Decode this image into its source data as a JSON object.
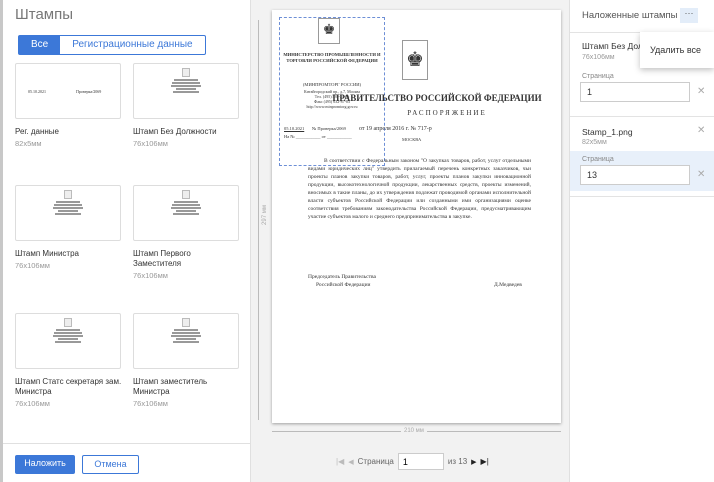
{
  "left": {
    "title": "Штампы",
    "filters": [
      "Все",
      "Регистрационные данные"
    ],
    "stamps": [
      {
        "name": "Рег. данные",
        "size": "82x5мм",
        "preview": [
          "05.10.2021",
          "Проверка/2069"
        ]
      },
      {
        "name": "Штамп Без Должности",
        "size": "76x106мм"
      },
      {
        "name": "Штамп Министра",
        "size": "76x106мм"
      },
      {
        "name": "Штамп Первого Заместителя",
        "size": "76x106мм"
      },
      {
        "name": "Штамп Статс секретаря зам. Министра",
        "size": "76x106мм"
      },
      {
        "name": "Штамп заместитель Министра",
        "size": "76x106мм"
      }
    ],
    "apply": "Наложить",
    "cancel": "Отмена"
  },
  "document": {
    "stamp": {
      "org": "МИНИСТЕРСТВО ПРОМЫШЛЕННОСТИ И ТОРГОВЛИ РОССИЙСКОЙ ФЕДЕРАЦИИ",
      "abbr": "(МИНПРОМТОРГ РОССИИ)",
      "addr": "Китайгородский пр., д.7, Москва",
      "tel": "Тел. (495) 539-21-66",
      "fax": "Факс (495) 632-87-83",
      "web": "http://www.minpromtorg.gov.ru",
      "date": "05.10.2021",
      "num": "№ Проверка/2069",
      "na": "На № ___________ от ___________"
    },
    "heading": "ПРАВИТЕЛЬСТВО РОССИЙСКОЙ ФЕДЕРАЦИИ",
    "type": "РАСПОРЯЖЕНИЕ",
    "dateline": "от 19 апреля 2016 г. № 717-р",
    "city": "МОСКВА",
    "body": "В соответствии с Федеральным законом \"О закупках товаров, работ, услуг отдельными видами юридических лиц\" утвердить прилагаемый перечень конкретных заказчиков, чьи проекты планов закупки товаров, работ, услуг, проекты планов закупки инновационной продукции, высокотехнологичной продукции, лекарственных средств, проекты изменений, вносимых в такие планы, до их утверждения подлежат проводимой органами исполнительной власти субъектов Российской Федерации или созданными ими организациями оценке соответствия требованиям законодательства Российской Федерации, предусматривающим участие субъектов малого и среднего предпринимательства в закупке.",
    "sign1": "Председатель Правительства",
    "sign2": "Российской Федерации",
    "signer": "Д.Медведев",
    "height_label": "297 мм",
    "width_label": "210 мм"
  },
  "pager": {
    "label": "Страница",
    "value": "1",
    "of": "из 13"
  },
  "right": {
    "title": "Наложенные штампы",
    "more": "···",
    "menu_item": "Удалить все",
    "items": [
      {
        "name": "Штамп Без Должности",
        "size": "76x106мм",
        "page_label": "Страница",
        "page": "1"
      },
      {
        "name": "Stamp_1.png",
        "size": "82x5мм",
        "page_label": "Страница",
        "page": "13"
      }
    ],
    "remove": "✕"
  }
}
